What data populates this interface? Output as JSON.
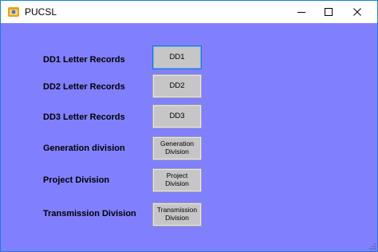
{
  "window": {
    "title": "PUCSL",
    "colors": {
      "client_background": "#8080ff",
      "button_face": "#c6c6c6",
      "focus_border": "#1e74d0",
      "window_border": "#1a7fd4"
    },
    "icons": {
      "app": "pucsl-app-icon",
      "minimize": "minimize-icon",
      "maximize": "maximize-icon",
      "close": "close-icon"
    }
  },
  "rows": [
    {
      "label": "DD1 Letter Records",
      "button": "DD1"
    },
    {
      "label": "DD2 Letter Records",
      "button": "DD2"
    },
    {
      "label": "DD3 Letter Records",
      "button": "DD3"
    },
    {
      "label": "Generation division",
      "button": "Generation\nDivision"
    },
    {
      "label": "Project Division",
      "button": "Project\nDivision"
    },
    {
      "label": "Transmission Division",
      "button": "Transmission\nDivision"
    }
  ]
}
